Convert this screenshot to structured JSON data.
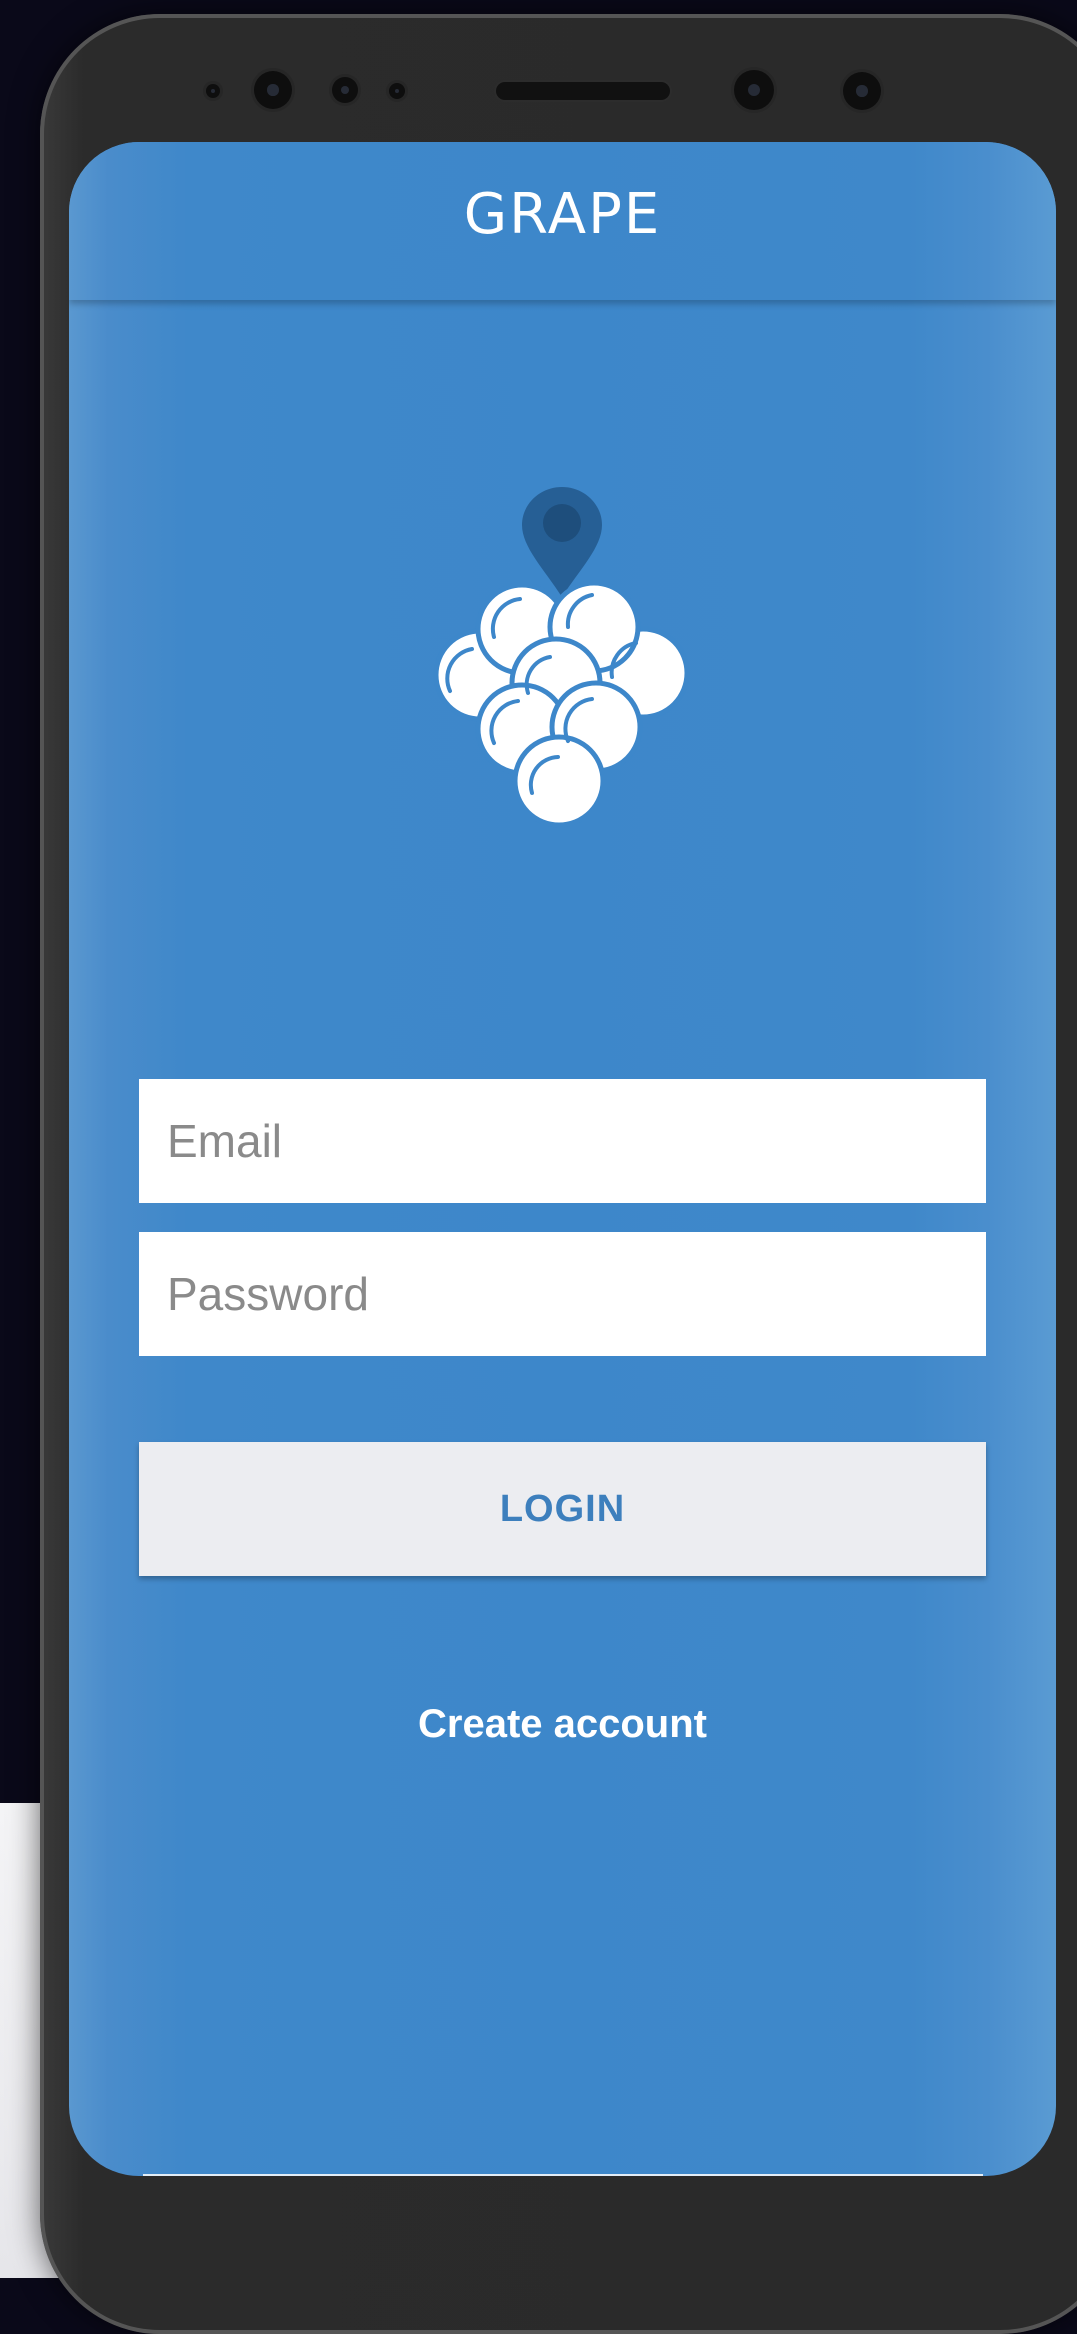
{
  "app": {
    "title": "GRAPE",
    "logo_icon": "grape-location-icon"
  },
  "form": {
    "email_placeholder": "Email",
    "password_placeholder": "Password",
    "login_label": "LOGIN",
    "create_account_label": "Create account"
  },
  "colors": {
    "primary_blue": "#3d87ca",
    "pin_blue": "#265f95",
    "button_bg": "#ecedf1",
    "button_text": "#3d7fbd"
  }
}
